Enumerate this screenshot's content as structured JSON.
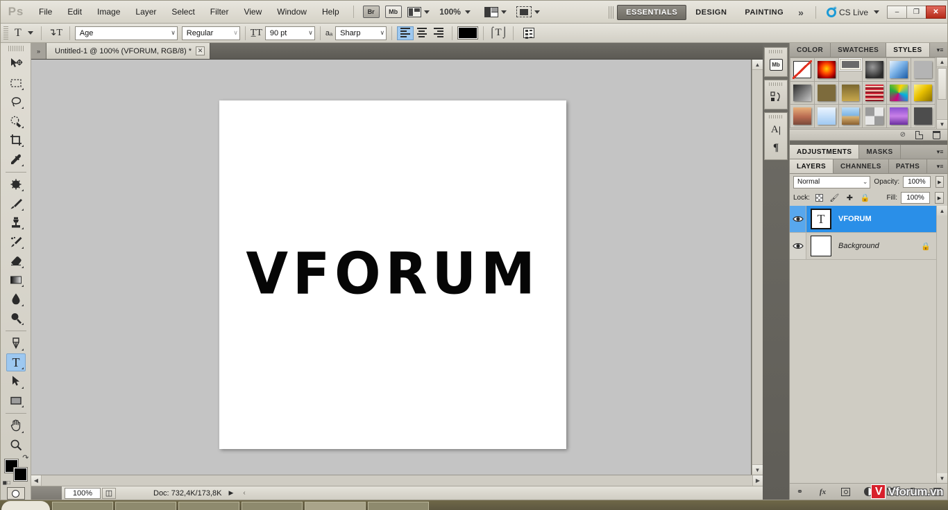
{
  "app": {
    "logo": "Ps",
    "title": "Adobe Photoshop"
  },
  "menubar": {
    "items": [
      "File",
      "Edit",
      "Image",
      "Layer",
      "Select",
      "Filter",
      "View",
      "Window",
      "Help"
    ],
    "bridge_label": "Br",
    "minibridge_label": "Mb",
    "zoom_level": "100%",
    "workspaces": [
      "ESSENTIALS",
      "DESIGN",
      "PAINTING"
    ],
    "workspace_active": "ESSENTIALS",
    "more_workspaces": "»",
    "cslive": "CS Live",
    "win_minimize": "–",
    "win_restore": "❐",
    "win_close": "✕"
  },
  "optionsbar": {
    "tool_glyph": "T",
    "orientation_icon": "orientation",
    "font_family": "Age",
    "font_style": "Regular",
    "font_size": "90 pt",
    "aa_label": "aₐ",
    "antialias": "Sharp",
    "align_left": "align-left",
    "align_center": "align-center",
    "align_right": "align-right",
    "color_hex": "#000000",
    "warp": "warp-text",
    "panels": "toggle-panels",
    "caret": "∨"
  },
  "tabs": {
    "arrows": "»",
    "document": "Untitled-1 @ 100% (VFORUM, RGB/8) *",
    "close": "✕"
  },
  "toolbox": {
    "tools": [
      {
        "name": "move-tool",
        "glyph": "move"
      },
      {
        "name": "rectangular-marquee-tool",
        "glyph": "marquee"
      },
      {
        "name": "lasso-tool",
        "glyph": "lasso"
      },
      {
        "name": "quick-selection-tool",
        "glyph": "quickselect"
      },
      {
        "name": "crop-tool",
        "glyph": "crop"
      },
      {
        "name": "eyedropper-tool",
        "glyph": "eyedropper"
      },
      {
        "name": "spot-healing-brush-tool",
        "glyph": "healing"
      },
      {
        "name": "brush-tool",
        "glyph": "brush"
      },
      {
        "name": "clone-stamp-tool",
        "glyph": "stamp"
      },
      {
        "name": "history-brush-tool",
        "glyph": "historybrush"
      },
      {
        "name": "eraser-tool",
        "glyph": "eraser"
      },
      {
        "name": "gradient-tool",
        "glyph": "gradient"
      },
      {
        "name": "blur-tool",
        "glyph": "blur"
      },
      {
        "name": "dodge-tool",
        "glyph": "dodge"
      },
      {
        "name": "pen-tool",
        "glyph": "pen"
      },
      {
        "name": "horizontal-type-tool",
        "glyph": "type"
      },
      {
        "name": "path-selection-tool",
        "glyph": "pathselect"
      },
      {
        "name": "rectangle-tool",
        "glyph": "shape"
      },
      {
        "name": "hand-tool",
        "glyph": "hand"
      },
      {
        "name": "zoom-tool",
        "glyph": "zoom"
      }
    ],
    "active_tool": "horizontal-type-tool",
    "foreground_color": "#000000",
    "background_color": "#000000"
  },
  "canvas": {
    "artwork_text": "VFORUM",
    "background": "#ffffff"
  },
  "statusbar": {
    "zoom": "100%",
    "doc_info": "Doc: 732,4K/173,8K",
    "play_arrow": "▶",
    "left_arrow": "‹"
  },
  "icondock": {
    "items": [
      {
        "name": "mini-bridge-icon",
        "label": "Mb"
      },
      {
        "name": "history-icon",
        "label": "↷"
      },
      {
        "name": "character-icon",
        "label": "A"
      },
      {
        "name": "paragraph-icon",
        "label": "¶"
      }
    ]
  },
  "styles_panel": {
    "tabs": [
      "COLOR",
      "SWATCHES",
      "STYLES"
    ],
    "active_tab": "STYLES",
    "menu_icon": "≡",
    "swatches": [
      {
        "name": "none",
        "css": "none"
      },
      {
        "name": "red-glow",
        "css": "radial-gradient(circle at 50% 45%, #ffd000 0%, #ff4800 38%, #b00000 70%, #2a0000 100%)"
      },
      {
        "name": "gray-bevel",
        "css": "#6a6a6a"
      },
      {
        "name": "dark-sphere",
        "css": "radial-gradient(circle at 40% 35%, #9a9a9a, #2b2b2b 72%)"
      },
      {
        "name": "blue-sky",
        "css": "linear-gradient(135deg,#e8f2fb 0%,#7cb3e8 45%,#1b5ca8 100%)"
      },
      {
        "name": "light-gray",
        "css": "#b4b4b4"
      },
      {
        "name": "gray-gradient",
        "css": "linear-gradient(135deg,#2b2b2b,#c9c9c9)"
      },
      {
        "name": "olive-flat",
        "css": "#7d6b3c"
      },
      {
        "name": "gold-gradient",
        "css": "linear-gradient(180deg,#7a6730,#c8a84c)"
      },
      {
        "name": "red-stripes",
        "css": "repeating-linear-gradient(180deg,#d42a3a 0 2px,#f2d2c0 2px 4px,#8b1a24 4px 6px)"
      },
      {
        "name": "rainbow-abstract",
        "css": "conic-gradient(from 20deg,#ffd400,#00b0e0,#d0007a,#22aa44,#ffd400)"
      },
      {
        "name": "yellow-bevel",
        "css": "linear-gradient(135deg,#fff27a,#e8c000 45%,#8a7000)"
      },
      {
        "name": "sunset",
        "css": "linear-gradient(180deg,#e8b07a,#b86a50 55%,#7a4a3a)"
      },
      {
        "name": "ice-blue",
        "css": "linear-gradient(180deg,#eaf4ff,#9fc9f2)"
      },
      {
        "name": "beach",
        "css": "linear-gradient(180deg,#bcdcf5 0%,#7fb6e6 45%,#d8b070 55%,#8a6030 100%)"
      },
      {
        "name": "noise-texture",
        "css": "repeating-conic-gradient(#e8e8e8 0% 25%, #9a9a9a 0% 50%)"
      },
      {
        "name": "purple-gradient",
        "css": "linear-gradient(180deg,#8a4fd0,#c880e8 50%,#6a2fa0)"
      },
      {
        "name": "charcoal",
        "css": "#4d4d4d"
      }
    ],
    "footer_icons": [
      "clear-style-icon",
      "new-style-icon",
      "delete-style-icon"
    ]
  },
  "adjustments_panel": {
    "tabs": [
      "ADJUSTMENTS",
      "MASKS"
    ],
    "active_tab": "ADJUSTMENTS",
    "menu_icon": "≡"
  },
  "layers_panel": {
    "tabs": [
      "LAYERS",
      "CHANNELS",
      "PATHS"
    ],
    "active_tab": "LAYERS",
    "menu_icon": "≡",
    "blend_mode": "Normal",
    "opacity_label": "Opacity:",
    "opacity_value": "100%",
    "lock_label": "Lock:",
    "lock_icons": [
      "lock-transparency-icon",
      "lock-image-icon",
      "lock-position-icon",
      "lock-all-icon"
    ],
    "fill_label": "Fill:",
    "fill_value": "100%",
    "layers": [
      {
        "name": "VFORUM",
        "type": "type",
        "thumb_glyph": "T",
        "visible": true,
        "selected": true,
        "locked": false,
        "italic": false
      },
      {
        "name": "Background",
        "type": "background",
        "thumb_glyph": "",
        "visible": true,
        "selected": false,
        "locked": true,
        "italic": true
      }
    ],
    "footer_icons": [
      "link-layers-icon",
      "layer-style-icon",
      "layer-mask-icon",
      "adjustment-layer-icon",
      "new-group-icon",
      "new-layer-icon",
      "delete-layer-icon"
    ],
    "fx_label": "fx",
    "link_label": "⚭"
  },
  "watermark": {
    "badge": "V",
    "text": "Vforum.vn"
  }
}
